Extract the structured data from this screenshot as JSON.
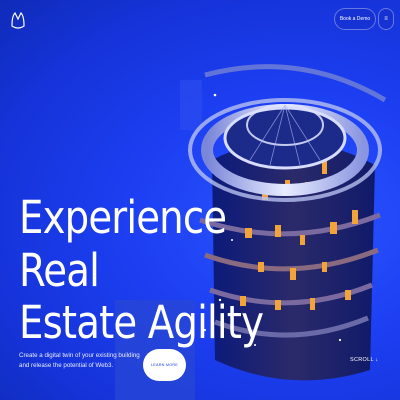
{
  "header": {
    "book_demo_label": "Book a Demo",
    "menu_icon_glyph": "≡"
  },
  "hero": {
    "headline_line1": "Experience Real",
    "headline_line2": "Estate Agility",
    "subtext": "Create a digital twin of your existing building and release the potential of Web3.",
    "cta_label": "LEARN MORE",
    "scroll_label": "SCROLL ↓"
  },
  "colors": {
    "background": "#1d3ff2",
    "accent_orange": "#f2a33a",
    "text": "#ffffff"
  }
}
